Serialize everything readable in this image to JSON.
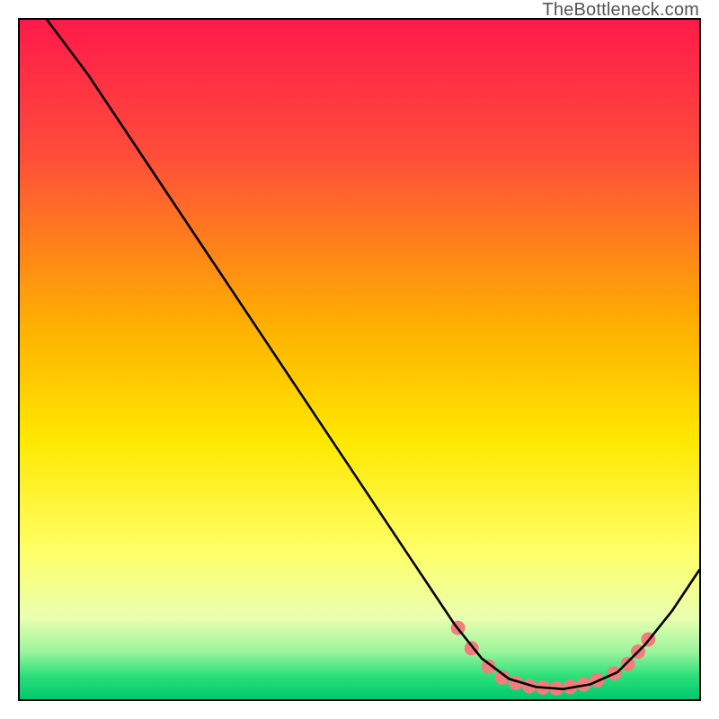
{
  "attribution": "TheBottleneck.com",
  "chart_data": {
    "type": "line",
    "title": "",
    "xlabel": "",
    "ylabel": "",
    "xlim": [
      0,
      100
    ],
    "ylim": [
      0,
      100
    ],
    "gradient_stops": [
      {
        "offset": 0,
        "color": "#ff1a4b"
      },
      {
        "offset": 0.2,
        "color": "#ff4d3a"
      },
      {
        "offset": 0.45,
        "color": "#ffb000"
      },
      {
        "offset": 0.62,
        "color": "#ffe800"
      },
      {
        "offset": 0.78,
        "color": "#ffff66"
      },
      {
        "offset": 0.88,
        "color": "#eaffb0"
      },
      {
        "offset": 0.93,
        "color": "#9cf59c"
      },
      {
        "offset": 0.965,
        "color": "#2de07a"
      },
      {
        "offset": 1.0,
        "color": "#00c86e"
      }
    ],
    "curve": [
      {
        "x": 4,
        "y": 100
      },
      {
        "x": 10,
        "y": 92
      },
      {
        "x": 14,
        "y": 86
      },
      {
        "x": 16,
        "y": 83
      },
      {
        "x": 20,
        "y": 77
      },
      {
        "x": 30,
        "y": 62
      },
      {
        "x": 40,
        "y": 47
      },
      {
        "x": 50,
        "y": 32
      },
      {
        "x": 58,
        "y": 20
      },
      {
        "x": 64,
        "y": 11
      },
      {
        "x": 68,
        "y": 6
      },
      {
        "x": 72,
        "y": 3
      },
      {
        "x": 76,
        "y": 1.8
      },
      {
        "x": 80,
        "y": 1.5
      },
      {
        "x": 84,
        "y": 2.2
      },
      {
        "x": 88,
        "y": 4
      },
      {
        "x": 92,
        "y": 8
      },
      {
        "x": 96,
        "y": 13
      },
      {
        "x": 100,
        "y": 19
      }
    ],
    "markers": [
      {
        "x": 64.5,
        "y": 10.5
      },
      {
        "x": 66.5,
        "y": 7.5
      },
      {
        "x": 69,
        "y": 4.8
      },
      {
        "x": 71,
        "y": 3.2
      },
      {
        "x": 73,
        "y": 2.4
      },
      {
        "x": 75,
        "y": 1.9
      },
      {
        "x": 77,
        "y": 1.7
      },
      {
        "x": 79,
        "y": 1.6
      },
      {
        "x": 81,
        "y": 1.8
      },
      {
        "x": 83,
        "y": 2.2
      },
      {
        "x": 85,
        "y": 2.8
      },
      {
        "x": 87.5,
        "y": 3.8
      },
      {
        "x": 89.5,
        "y": 5.2
      },
      {
        "x": 91,
        "y": 7.0
      },
      {
        "x": 92.5,
        "y": 8.8
      }
    ],
    "marker_color": "#f47c7c",
    "marker_radius": 8,
    "curve_color": "#000000",
    "curve_width": 2.6
  }
}
